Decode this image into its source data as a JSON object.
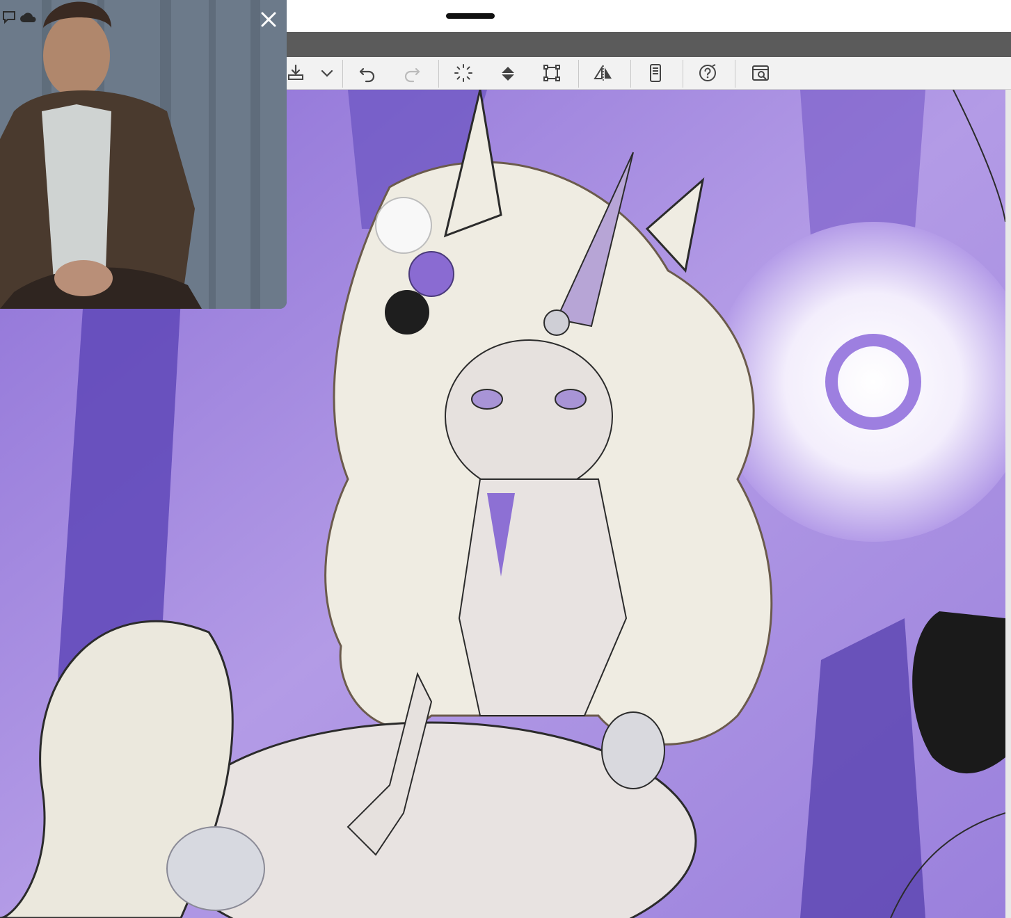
{
  "window": {
    "status_bar": "",
    "accent_color": "#7e5bd0"
  },
  "toolbar": {
    "items": [
      {
        "name": "import-icon"
      },
      {
        "name": "chevron-down-icon"
      },
      {
        "name": "undo-icon"
      },
      {
        "name": "redo-icon"
      },
      {
        "name": "loading-spinner-icon"
      },
      {
        "name": "fill-bucket-icon"
      },
      {
        "name": "transform-icon"
      },
      {
        "name": "flip-horizontal-icon"
      },
      {
        "name": "device-icon"
      },
      {
        "name": "help-icon"
      },
      {
        "name": "view-search-icon"
      }
    ]
  },
  "overlay": {
    "close_icon": "close-icon",
    "streaming_icons": [
      "chat-icon",
      "cloud-icon"
    ]
  },
  "canvas": {
    "artwork": "illustration-canvas",
    "palette": {
      "background": "#a98be0",
      "deep": "#5f48b8",
      "hair": "#efece2",
      "outline": "#2b2b2b"
    }
  }
}
